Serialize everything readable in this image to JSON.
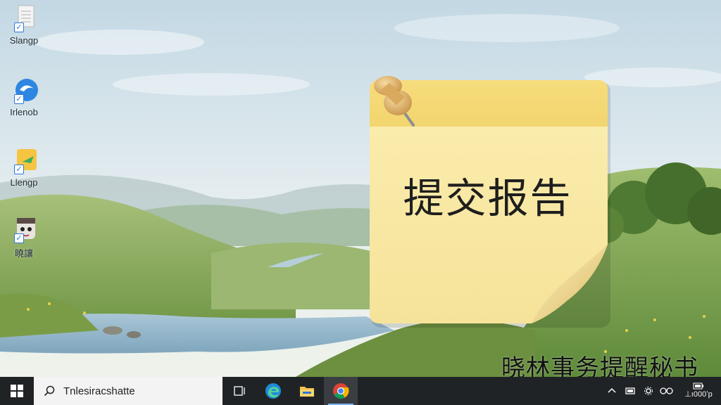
{
  "desktop": {
    "icons": [
      {
        "label": "Slangp",
        "icon": "document-icon"
      },
      {
        "label": "Irlenob",
        "icon": "edge-blue-icon"
      },
      {
        "label": "Llengp",
        "icon": "notes-app-icon"
      },
      {
        "label": "曉讓",
        "icon": "avatar-app-icon"
      }
    ]
  },
  "sticky_note": {
    "text": "提交报告",
    "color": "#f7e6a0"
  },
  "watermark": "晓林事务提醒秘书",
  "taskbar": {
    "search_placeholder": "Tnlesiracshatte",
    "apps": [
      "task-view-icon",
      "edge-browser-icon",
      "file-explorer-icon",
      "chrome-browser-icon"
    ],
    "active_app": "chrome-browser-icon",
    "tray_icons": [
      "chevron-up-icon",
      "display-icon",
      "settings-gear-icon",
      "network-icon"
    ],
    "clock": {
      "top": "",
      "bottom": "⊥ı000ʼp"
    }
  }
}
